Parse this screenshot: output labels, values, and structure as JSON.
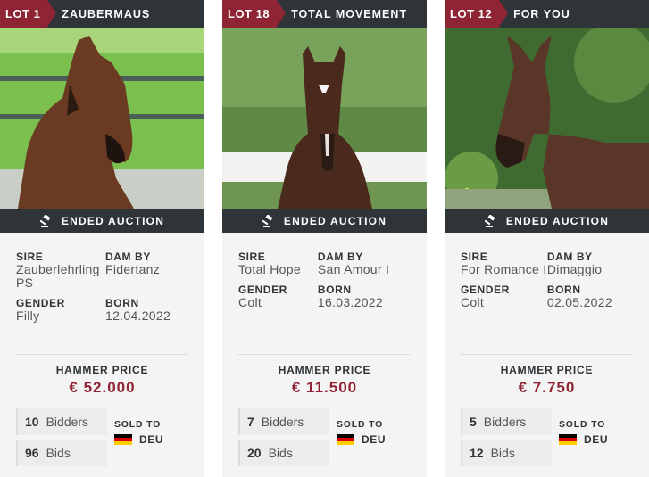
{
  "status_label": "ENDED AUCTION",
  "labels": {
    "sire": "SIRE",
    "dam_by": "DAM BY",
    "gender": "GENDER",
    "born": "BORN",
    "hammer_price": "HAMMER PRICE",
    "bidders": "Bidders",
    "bids": "Bids",
    "sold_to": "SOLD TO"
  },
  "colors": {
    "accent": "#8e2434",
    "bar": "#2e3438"
  },
  "flag_colors": [
    "#000000",
    "#dd0000",
    "#ffce00"
  ],
  "cards": [
    {
      "lot": "LOT 1",
      "name": "ZAUBERMAUS",
      "sire": "Zauberlehrling PS",
      "dam_by": "Fidertanz",
      "gender": "Filly",
      "born": "12.04.2022",
      "price": "€ 52.000",
      "bidders": "10",
      "bids": "96",
      "country": "DEU"
    },
    {
      "lot": "LOT 18",
      "name": "TOTAL MOVEMENT",
      "sire": "Total Hope",
      "dam_by": "San Amour I",
      "gender": "Colt",
      "born": "16.03.2022",
      "price": "€ 11.500",
      "bidders": "7",
      "bids": "20",
      "country": "DEU"
    },
    {
      "lot": "LOT 12",
      "name": "FOR YOU",
      "sire": "For Romance I",
      "dam_by": "Dimaggio",
      "gender": "Colt",
      "born": "02.05.2022",
      "price": "€ 7.750",
      "bidders": "5",
      "bids": "12",
      "country": "DEU"
    }
  ]
}
